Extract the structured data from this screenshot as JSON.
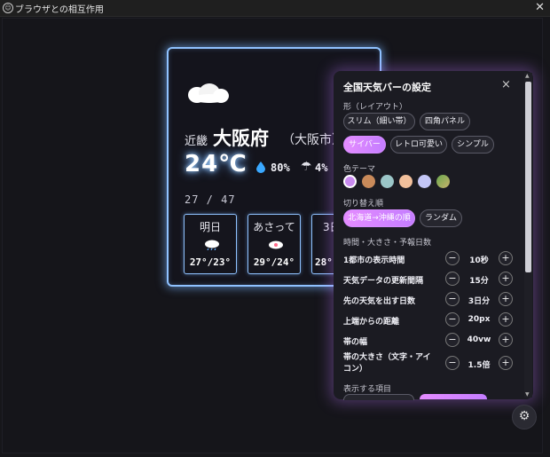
{
  "window": {
    "title": "ブラウザとの相互作用"
  },
  "weather": {
    "region": "近畿",
    "prefecture": "大阪府",
    "city": "（大阪市）",
    "temperature": "24℃",
    "humidity": "80%",
    "rain_chance": "4%",
    "date": "27 / 47",
    "forecast": [
      {
        "label": "明日",
        "temps": "27°/23°"
      },
      {
        "label": "あさって",
        "temps": "29°/24°"
      },
      {
        "label": "3日",
        "temps": "28°"
      }
    ]
  },
  "settings": {
    "title": "全国天気バーの設定",
    "close": "×",
    "shape_label": "形（レイアウト）",
    "shape_options": [
      "スリム（細い帯）",
      "四角パネル"
    ],
    "style_options": [
      "サイバー",
      "レトロ可愛い",
      "シンプル"
    ],
    "style_selected": "サイバー",
    "color_label": "色テーマ",
    "color_swatches": [
      "#c98bf0",
      "#c98a5a",
      "#9bc6c8",
      "#f2c09c",
      "#c3c6f6",
      "#7fb87a"
    ],
    "order_label": "切り替え順",
    "order_options": [
      "北海道→沖縄の順",
      "ランダム"
    ],
    "order_selected": "北海道→沖縄の順",
    "time_label": "時間・大きさ・予報日数",
    "rows": [
      {
        "label": "1都市の表示時間",
        "value": "10秒"
      },
      {
        "label": "天気データの更新間隔",
        "value": "15分"
      },
      {
        "label": "先の天気を出す日数",
        "value": "3日分"
      },
      {
        "label": "上端からの距離",
        "value": "20px"
      },
      {
        "label": "帯の幅",
        "value": "40vw"
      },
      {
        "label": "帯の大きさ（文字・アイコン）",
        "value": "1.5倍"
      }
    ],
    "minus": "−",
    "plus": "+",
    "display_label": "表示する項目"
  },
  "colors": {
    "accent": "#d58cff",
    "card_glow": "#8fc2ff"
  }
}
